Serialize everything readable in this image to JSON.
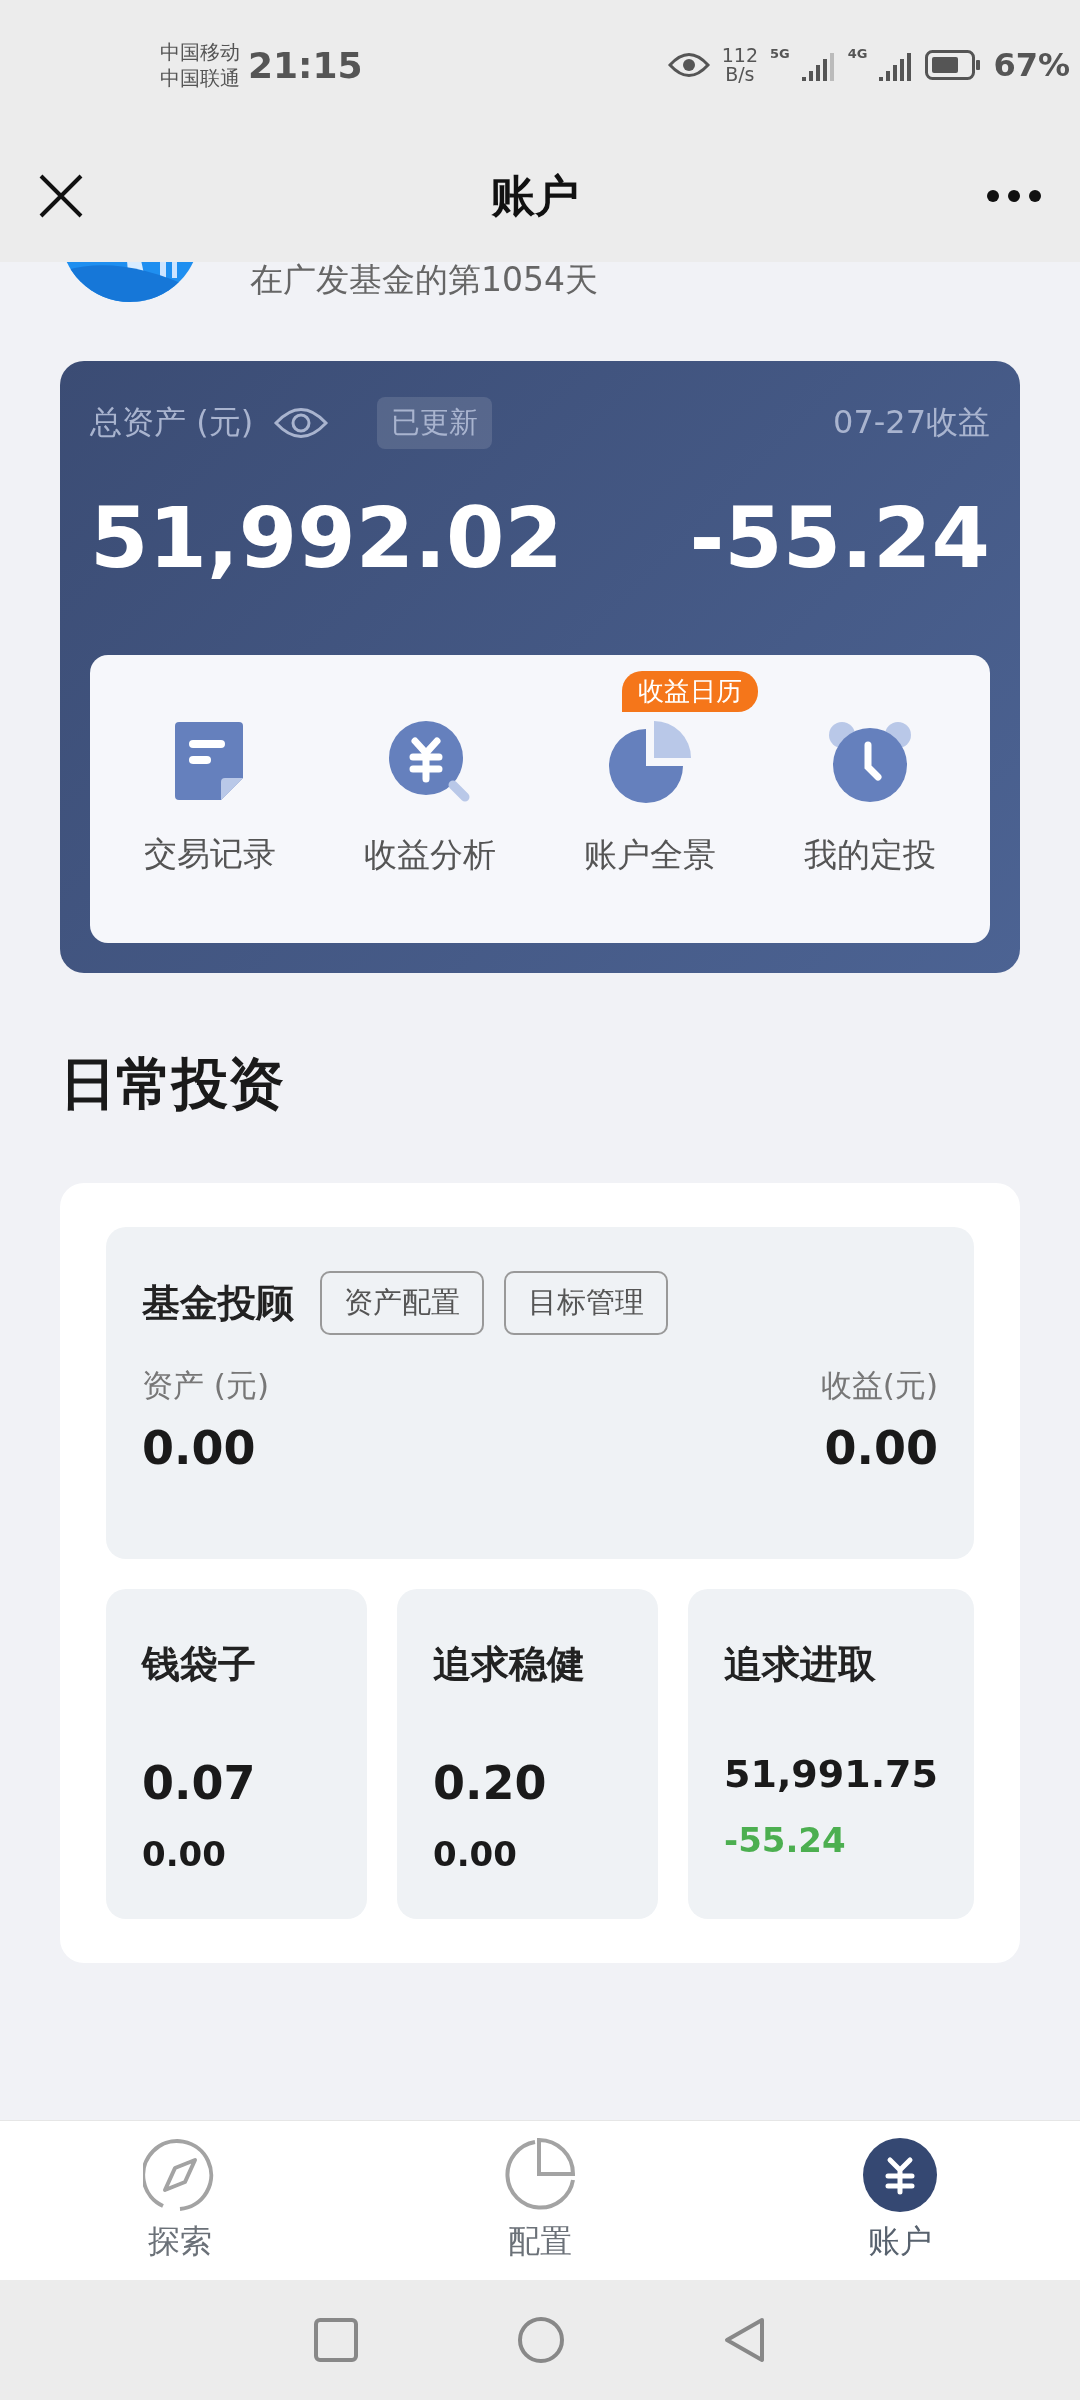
{
  "status_bar": {
    "carriers": [
      "中国移动",
      "中国联通"
    ],
    "time": "21:15",
    "net_speed": [
      "112",
      "B/s"
    ],
    "networks": [
      "5G",
      "4G"
    ],
    "battery": "67%"
  },
  "header": {
    "title": "账户"
  },
  "profile": {
    "subtitle": "在广发基金的第1054天"
  },
  "summary": {
    "label": "总资产 (元)",
    "badge": "已更新",
    "date_label": "07-27收益",
    "total": "51,992.02",
    "daily": "-55.24"
  },
  "shortcuts": [
    {
      "kind": "record",
      "label": "交易记录"
    },
    {
      "kind": "analysis",
      "label": "收益分析"
    },
    {
      "kind": "overview",
      "label": "账户全景",
      "badge": "收益日历"
    },
    {
      "kind": "plan",
      "label": "我的定投"
    }
  ],
  "section_title": "日常投资",
  "advisor": {
    "title": "基金投顾",
    "tags": [
      "资产配置",
      "目标管理"
    ],
    "asset_label": "资产 (元)",
    "income_label": "收益(元)",
    "asset": "0.00",
    "income": "0.00"
  },
  "pockets": [
    {
      "name": "钱袋子",
      "amount": "0.07",
      "change": "0.00",
      "color": "#1a1a1a"
    },
    {
      "name": "追求稳健",
      "amount": "0.20",
      "change": "0.00",
      "color": "#1a1a1a"
    },
    {
      "name": "追求进取",
      "amount": "51,991.75",
      "change": "-55.24",
      "color": "#4caf50"
    }
  ],
  "nav": [
    {
      "kind": "explore",
      "label": "探索",
      "selected": false
    },
    {
      "kind": "allocation",
      "label": "配置",
      "selected": false
    },
    {
      "kind": "account",
      "label": "账户",
      "selected": true
    }
  ]
}
